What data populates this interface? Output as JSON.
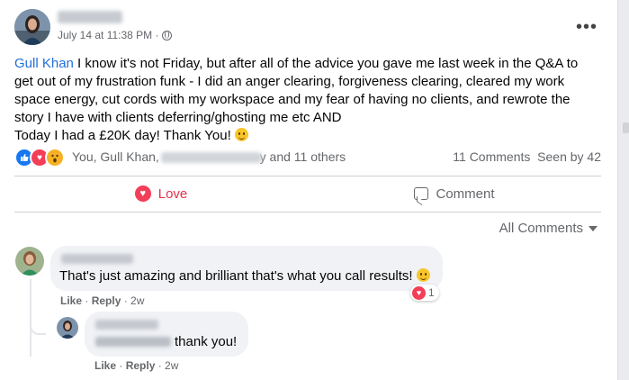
{
  "post": {
    "timestamp": "July 14 at 11:38 PM · ",
    "privacy_icon": "globe-icon",
    "mention": "Gull Khan",
    "body_main": " I know it's not Friday, but after all of the advice you gave me last week in the Q&A to get out of my frustration funk - I did an anger clearing, forgiveness clearing, cleared my work space energy, cut cords with my workspace and my fear of having no clients, and rewrote the story I have with clients deferring/ghosting me etc AND",
    "body_last": "Today I had a £20K day! Thank You! ",
    "reactions_prefix": "You, Gull Khan, ",
    "reactions_suffix": "y and 11 others",
    "comments_count": "11 Comments",
    "seen_by": "Seen by 42"
  },
  "actions": {
    "love_label": "Love",
    "comment_label": "Comment"
  },
  "comments_sort": "All Comments",
  "comments": [
    {
      "text": "That's just amazing and brilliant that's what you call results! ",
      "like": "Like",
      "reply": "Reply",
      "age": "2w",
      "reaction_count": "1"
    },
    {
      "text": "thank you!",
      "like": "Like",
      "reply": "Reply",
      "age": "2w"
    }
  ],
  "colors": {
    "accent": "#1877f2",
    "love": "#f33e58",
    "mention": "#216fdb"
  }
}
